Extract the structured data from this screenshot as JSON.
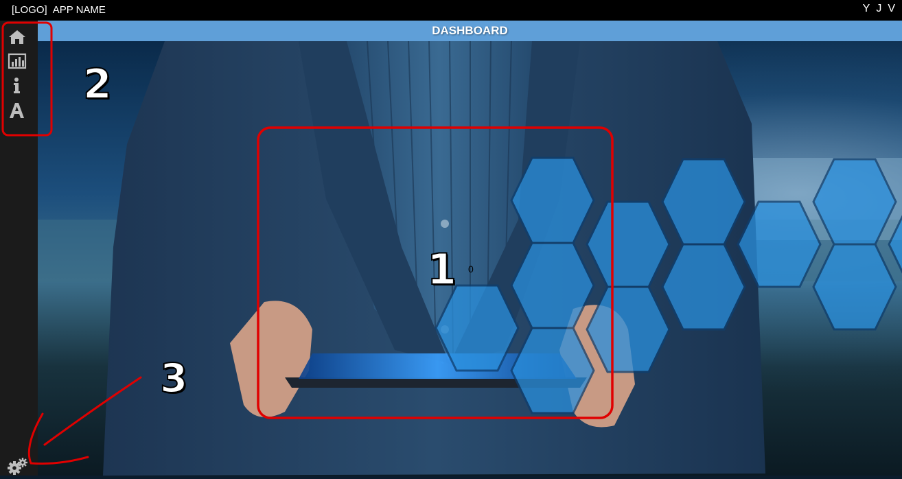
{
  "topbar": {
    "logo": "[LOGO]",
    "app_name": "APP NAME",
    "user_initials": [
      "Y",
      "J",
      "V"
    ]
  },
  "sidebar": {
    "items": [
      {
        "icon": "home-icon"
      },
      {
        "icon": "bar-chart-icon"
      },
      {
        "icon": "info-icon"
      },
      {
        "icon": "font-icon"
      }
    ],
    "settings_icon": "gears-icon"
  },
  "header": {
    "title": "DASHBOARD"
  },
  "main": {
    "tile_value": "0",
    "background_image": "businessman holding tablet with blue hexagons over city skyline"
  },
  "annotations": {
    "labels": [
      "1",
      "2",
      "3"
    ],
    "color": "#e00000"
  },
  "colors": {
    "topbar": "#000000",
    "sidebar": "#1b1b1b",
    "titlebar": "#5f9fd8",
    "hexagon": "#2a8fdc"
  }
}
